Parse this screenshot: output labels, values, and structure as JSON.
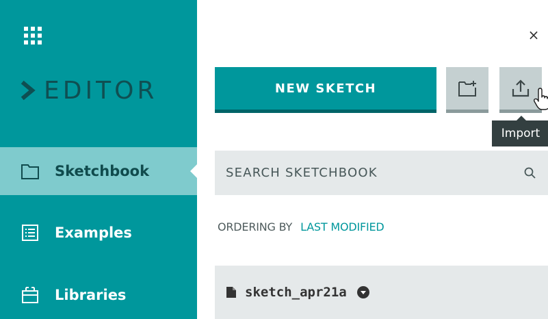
{
  "sidebar": {
    "brand": "EDITOR",
    "items": [
      {
        "label": "Sketchbook",
        "active": true,
        "icon": "folder-icon"
      },
      {
        "label": "Examples",
        "active": false,
        "icon": "list-icon"
      },
      {
        "label": "Libraries",
        "active": false,
        "icon": "library-icon"
      }
    ]
  },
  "toolbar": {
    "close_label": "×",
    "new_sketch_label": "NEW SKETCH",
    "new_folder_icon": "new-folder-icon",
    "import_icon": "upload-icon",
    "import_tooltip": "Import"
  },
  "search": {
    "placeholder": "SEARCH SKETCHBOOK"
  },
  "ordering": {
    "label": "ORDERING BY",
    "value": "LAST MODIFIED"
  },
  "sketches": [
    {
      "name": "sketch_apr21a"
    }
  ],
  "colors": {
    "sidebar_bg": "#00979c",
    "active_item_bg": "#7fcbcd",
    "accent": "#00979c",
    "panel_bg": "#e5e9ea"
  }
}
